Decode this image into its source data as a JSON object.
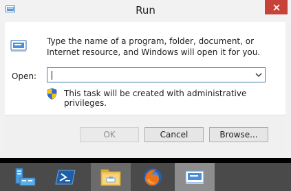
{
  "window": {
    "title": "Run"
  },
  "dialog": {
    "description": "Type the name of a program, folder, document, or Internet resource, and Windows will open it for you.",
    "open_label": "Open:",
    "open_value": "",
    "admin_note": "This task will be created with administrative privileges."
  },
  "buttons": {
    "ok": "OK",
    "cancel": "Cancel",
    "browse": "Browse..."
  },
  "taskbar": {
    "items": [
      {
        "icon": "server-manager-icon"
      },
      {
        "icon": "powershell-icon"
      },
      {
        "icon": "file-explorer-icon"
      },
      {
        "icon": "firefox-icon"
      },
      {
        "icon": "run-icon"
      }
    ]
  },
  "colors": {
    "close_button": "#c7433a",
    "taskbar": "#4a4a4a",
    "input_border": "#3c7fb1"
  }
}
